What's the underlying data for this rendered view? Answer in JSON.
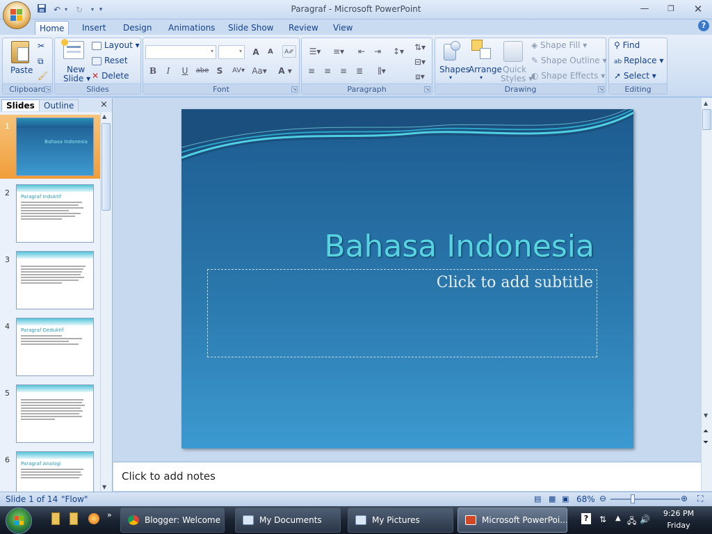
{
  "window": {
    "title": "Paragraf - Microsoft PowerPoint"
  },
  "quick_access": {
    "save": "save",
    "undo": "undo",
    "redo": "redo",
    "customize": "customize"
  },
  "ribbon_tabs": [
    "Home",
    "Insert",
    "Design",
    "Animations",
    "Slide Show",
    "Review",
    "View"
  ],
  "groups": {
    "clipboard": {
      "label": "Clipboard",
      "paste": "Paste"
    },
    "slides": {
      "label": "Slides",
      "new_slide_line1": "New",
      "new_slide_line2": "Slide",
      "layout": "Layout",
      "reset": "Reset",
      "delete": "Delete"
    },
    "font": {
      "label": "Font",
      "bold": "B",
      "italic": "I",
      "underline": "U",
      "strike": "abe",
      "shadow": "S",
      "spacing": "AV",
      "case": "Aa",
      "color": "A",
      "grow": "A",
      "shrink": "A"
    },
    "paragraph": {
      "label": "Paragraph"
    },
    "drawing": {
      "label": "Drawing",
      "shapes": "Shapes",
      "arrange": "Arrange",
      "quick_styles_line1": "Quick",
      "quick_styles_line2": "Styles",
      "shape_fill": "Shape Fill",
      "shape_outline": "Shape Outline",
      "shape_effects": "Shape Effects"
    },
    "editing": {
      "label": "Editing",
      "find": "Find",
      "replace": "Replace",
      "select": "Select"
    }
  },
  "panel": {
    "tabs": [
      "Slides",
      "Outline"
    ],
    "close": "×",
    "thumbnails": [
      {
        "num": "1",
        "title": "Bahasa Indonesia"
      },
      {
        "num": "2",
        "title": "Paragraf Induktif"
      },
      {
        "num": "3",
        "title": ""
      },
      {
        "num": "4",
        "title": "Paragraf Deduktif"
      },
      {
        "num": "5",
        "title": ""
      },
      {
        "num": "6",
        "title": "Paragraf Analogi"
      }
    ]
  },
  "slide": {
    "title": "Bahasa Indonesia",
    "subtitle_placeholder": "Click to add subtitle"
  },
  "notes": {
    "placeholder": "Click to add notes"
  },
  "status": {
    "slide_info": "Slide 1 of 14",
    "theme": "\"Flow\"",
    "zoom": "68%",
    "zoom_level": 0.68
  },
  "taskbar": {
    "buttons": [
      "Blogger: Welcome ...",
      "My Documents",
      "My Pictures",
      "Microsoft PowerPoi..."
    ],
    "time": "9:26 PM",
    "day": "Friday"
  },
  "colors": {
    "slide_bg": "#2a78ad",
    "title_accent": "#57d4e0",
    "ribbon_text": "#15428b"
  }
}
